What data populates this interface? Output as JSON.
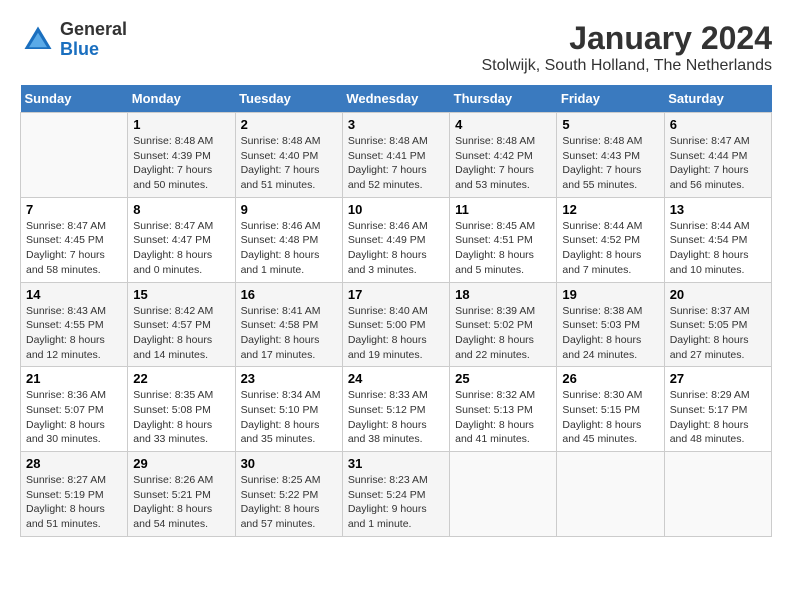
{
  "logo": {
    "general": "General",
    "blue": "Blue"
  },
  "title": "January 2024",
  "subtitle": "Stolwijk, South Holland, The Netherlands",
  "days_header": [
    "Sunday",
    "Monday",
    "Tuesday",
    "Wednesday",
    "Thursday",
    "Friday",
    "Saturday"
  ],
  "weeks": [
    [
      {
        "day": "",
        "info": ""
      },
      {
        "day": "1",
        "info": "Sunrise: 8:48 AM\nSunset: 4:39 PM\nDaylight: 7 hours\nand 50 minutes."
      },
      {
        "day": "2",
        "info": "Sunrise: 8:48 AM\nSunset: 4:40 PM\nDaylight: 7 hours\nand 51 minutes."
      },
      {
        "day": "3",
        "info": "Sunrise: 8:48 AM\nSunset: 4:41 PM\nDaylight: 7 hours\nand 52 minutes."
      },
      {
        "day": "4",
        "info": "Sunrise: 8:48 AM\nSunset: 4:42 PM\nDaylight: 7 hours\nand 53 minutes."
      },
      {
        "day": "5",
        "info": "Sunrise: 8:48 AM\nSunset: 4:43 PM\nDaylight: 7 hours\nand 55 minutes."
      },
      {
        "day": "6",
        "info": "Sunrise: 8:47 AM\nSunset: 4:44 PM\nDaylight: 7 hours\nand 56 minutes."
      }
    ],
    [
      {
        "day": "7",
        "info": "Sunrise: 8:47 AM\nSunset: 4:45 PM\nDaylight: 7 hours\nand 58 minutes."
      },
      {
        "day": "8",
        "info": "Sunrise: 8:47 AM\nSunset: 4:47 PM\nDaylight: 8 hours\nand 0 minutes."
      },
      {
        "day": "9",
        "info": "Sunrise: 8:46 AM\nSunset: 4:48 PM\nDaylight: 8 hours\nand 1 minute."
      },
      {
        "day": "10",
        "info": "Sunrise: 8:46 AM\nSunset: 4:49 PM\nDaylight: 8 hours\nand 3 minutes."
      },
      {
        "day": "11",
        "info": "Sunrise: 8:45 AM\nSunset: 4:51 PM\nDaylight: 8 hours\nand 5 minutes."
      },
      {
        "day": "12",
        "info": "Sunrise: 8:44 AM\nSunset: 4:52 PM\nDaylight: 8 hours\nand 7 minutes."
      },
      {
        "day": "13",
        "info": "Sunrise: 8:44 AM\nSunset: 4:54 PM\nDaylight: 8 hours\nand 10 minutes."
      }
    ],
    [
      {
        "day": "14",
        "info": "Sunrise: 8:43 AM\nSunset: 4:55 PM\nDaylight: 8 hours\nand 12 minutes."
      },
      {
        "day": "15",
        "info": "Sunrise: 8:42 AM\nSunset: 4:57 PM\nDaylight: 8 hours\nand 14 minutes."
      },
      {
        "day": "16",
        "info": "Sunrise: 8:41 AM\nSunset: 4:58 PM\nDaylight: 8 hours\nand 17 minutes."
      },
      {
        "day": "17",
        "info": "Sunrise: 8:40 AM\nSunset: 5:00 PM\nDaylight: 8 hours\nand 19 minutes."
      },
      {
        "day": "18",
        "info": "Sunrise: 8:39 AM\nSunset: 5:02 PM\nDaylight: 8 hours\nand 22 minutes."
      },
      {
        "day": "19",
        "info": "Sunrise: 8:38 AM\nSunset: 5:03 PM\nDaylight: 8 hours\nand 24 minutes."
      },
      {
        "day": "20",
        "info": "Sunrise: 8:37 AM\nSunset: 5:05 PM\nDaylight: 8 hours\nand 27 minutes."
      }
    ],
    [
      {
        "day": "21",
        "info": "Sunrise: 8:36 AM\nSunset: 5:07 PM\nDaylight: 8 hours\nand 30 minutes."
      },
      {
        "day": "22",
        "info": "Sunrise: 8:35 AM\nSunset: 5:08 PM\nDaylight: 8 hours\nand 33 minutes."
      },
      {
        "day": "23",
        "info": "Sunrise: 8:34 AM\nSunset: 5:10 PM\nDaylight: 8 hours\nand 35 minutes."
      },
      {
        "day": "24",
        "info": "Sunrise: 8:33 AM\nSunset: 5:12 PM\nDaylight: 8 hours\nand 38 minutes."
      },
      {
        "day": "25",
        "info": "Sunrise: 8:32 AM\nSunset: 5:13 PM\nDaylight: 8 hours\nand 41 minutes."
      },
      {
        "day": "26",
        "info": "Sunrise: 8:30 AM\nSunset: 5:15 PM\nDaylight: 8 hours\nand 45 minutes."
      },
      {
        "day": "27",
        "info": "Sunrise: 8:29 AM\nSunset: 5:17 PM\nDaylight: 8 hours\nand 48 minutes."
      }
    ],
    [
      {
        "day": "28",
        "info": "Sunrise: 8:27 AM\nSunset: 5:19 PM\nDaylight: 8 hours\nand 51 minutes."
      },
      {
        "day": "29",
        "info": "Sunrise: 8:26 AM\nSunset: 5:21 PM\nDaylight: 8 hours\nand 54 minutes."
      },
      {
        "day": "30",
        "info": "Sunrise: 8:25 AM\nSunset: 5:22 PM\nDaylight: 8 hours\nand 57 minutes."
      },
      {
        "day": "31",
        "info": "Sunrise: 8:23 AM\nSunset: 5:24 PM\nDaylight: 9 hours\nand 1 minute."
      },
      {
        "day": "",
        "info": ""
      },
      {
        "day": "",
        "info": ""
      },
      {
        "day": "",
        "info": ""
      }
    ]
  ]
}
